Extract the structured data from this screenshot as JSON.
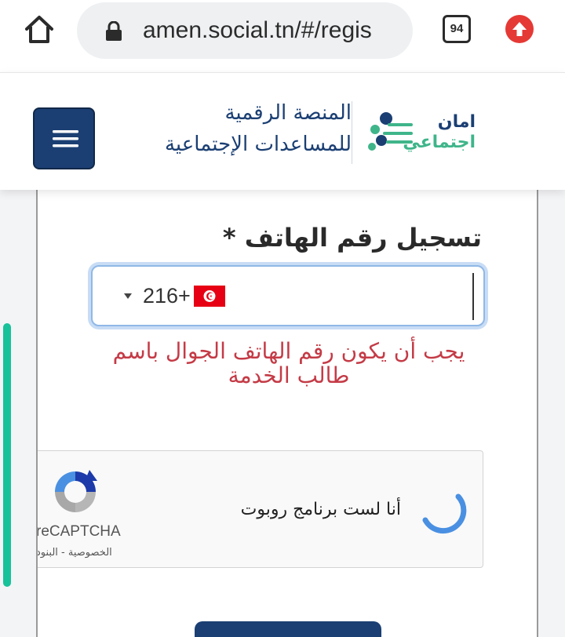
{
  "browser": {
    "url": "amen.social.tn/#/regis",
    "tab_count": "94"
  },
  "header": {
    "title": "المنصة الرقمية",
    "subtitle": "للمساعدات الإجتماعية",
    "logo_line1": "امان",
    "logo_line2": "اجتماعي"
  },
  "form": {
    "phone_label": "تسجيل رقم الهاتف *",
    "country_code": "216+",
    "error_message": "يجب أن يكون رقم الهاتف الجوال باسم طالب الخدمة"
  },
  "recaptcha": {
    "label": "أنا لست برنامج روبوت",
    "brand": "reCAPTCHA",
    "links": "الخصوصية - البنود"
  },
  "colors": {
    "primary": "#1b3f73",
    "accent_green": "#3fb58a",
    "error": "#c43b46",
    "scroll_indicator": "#17c29a"
  }
}
